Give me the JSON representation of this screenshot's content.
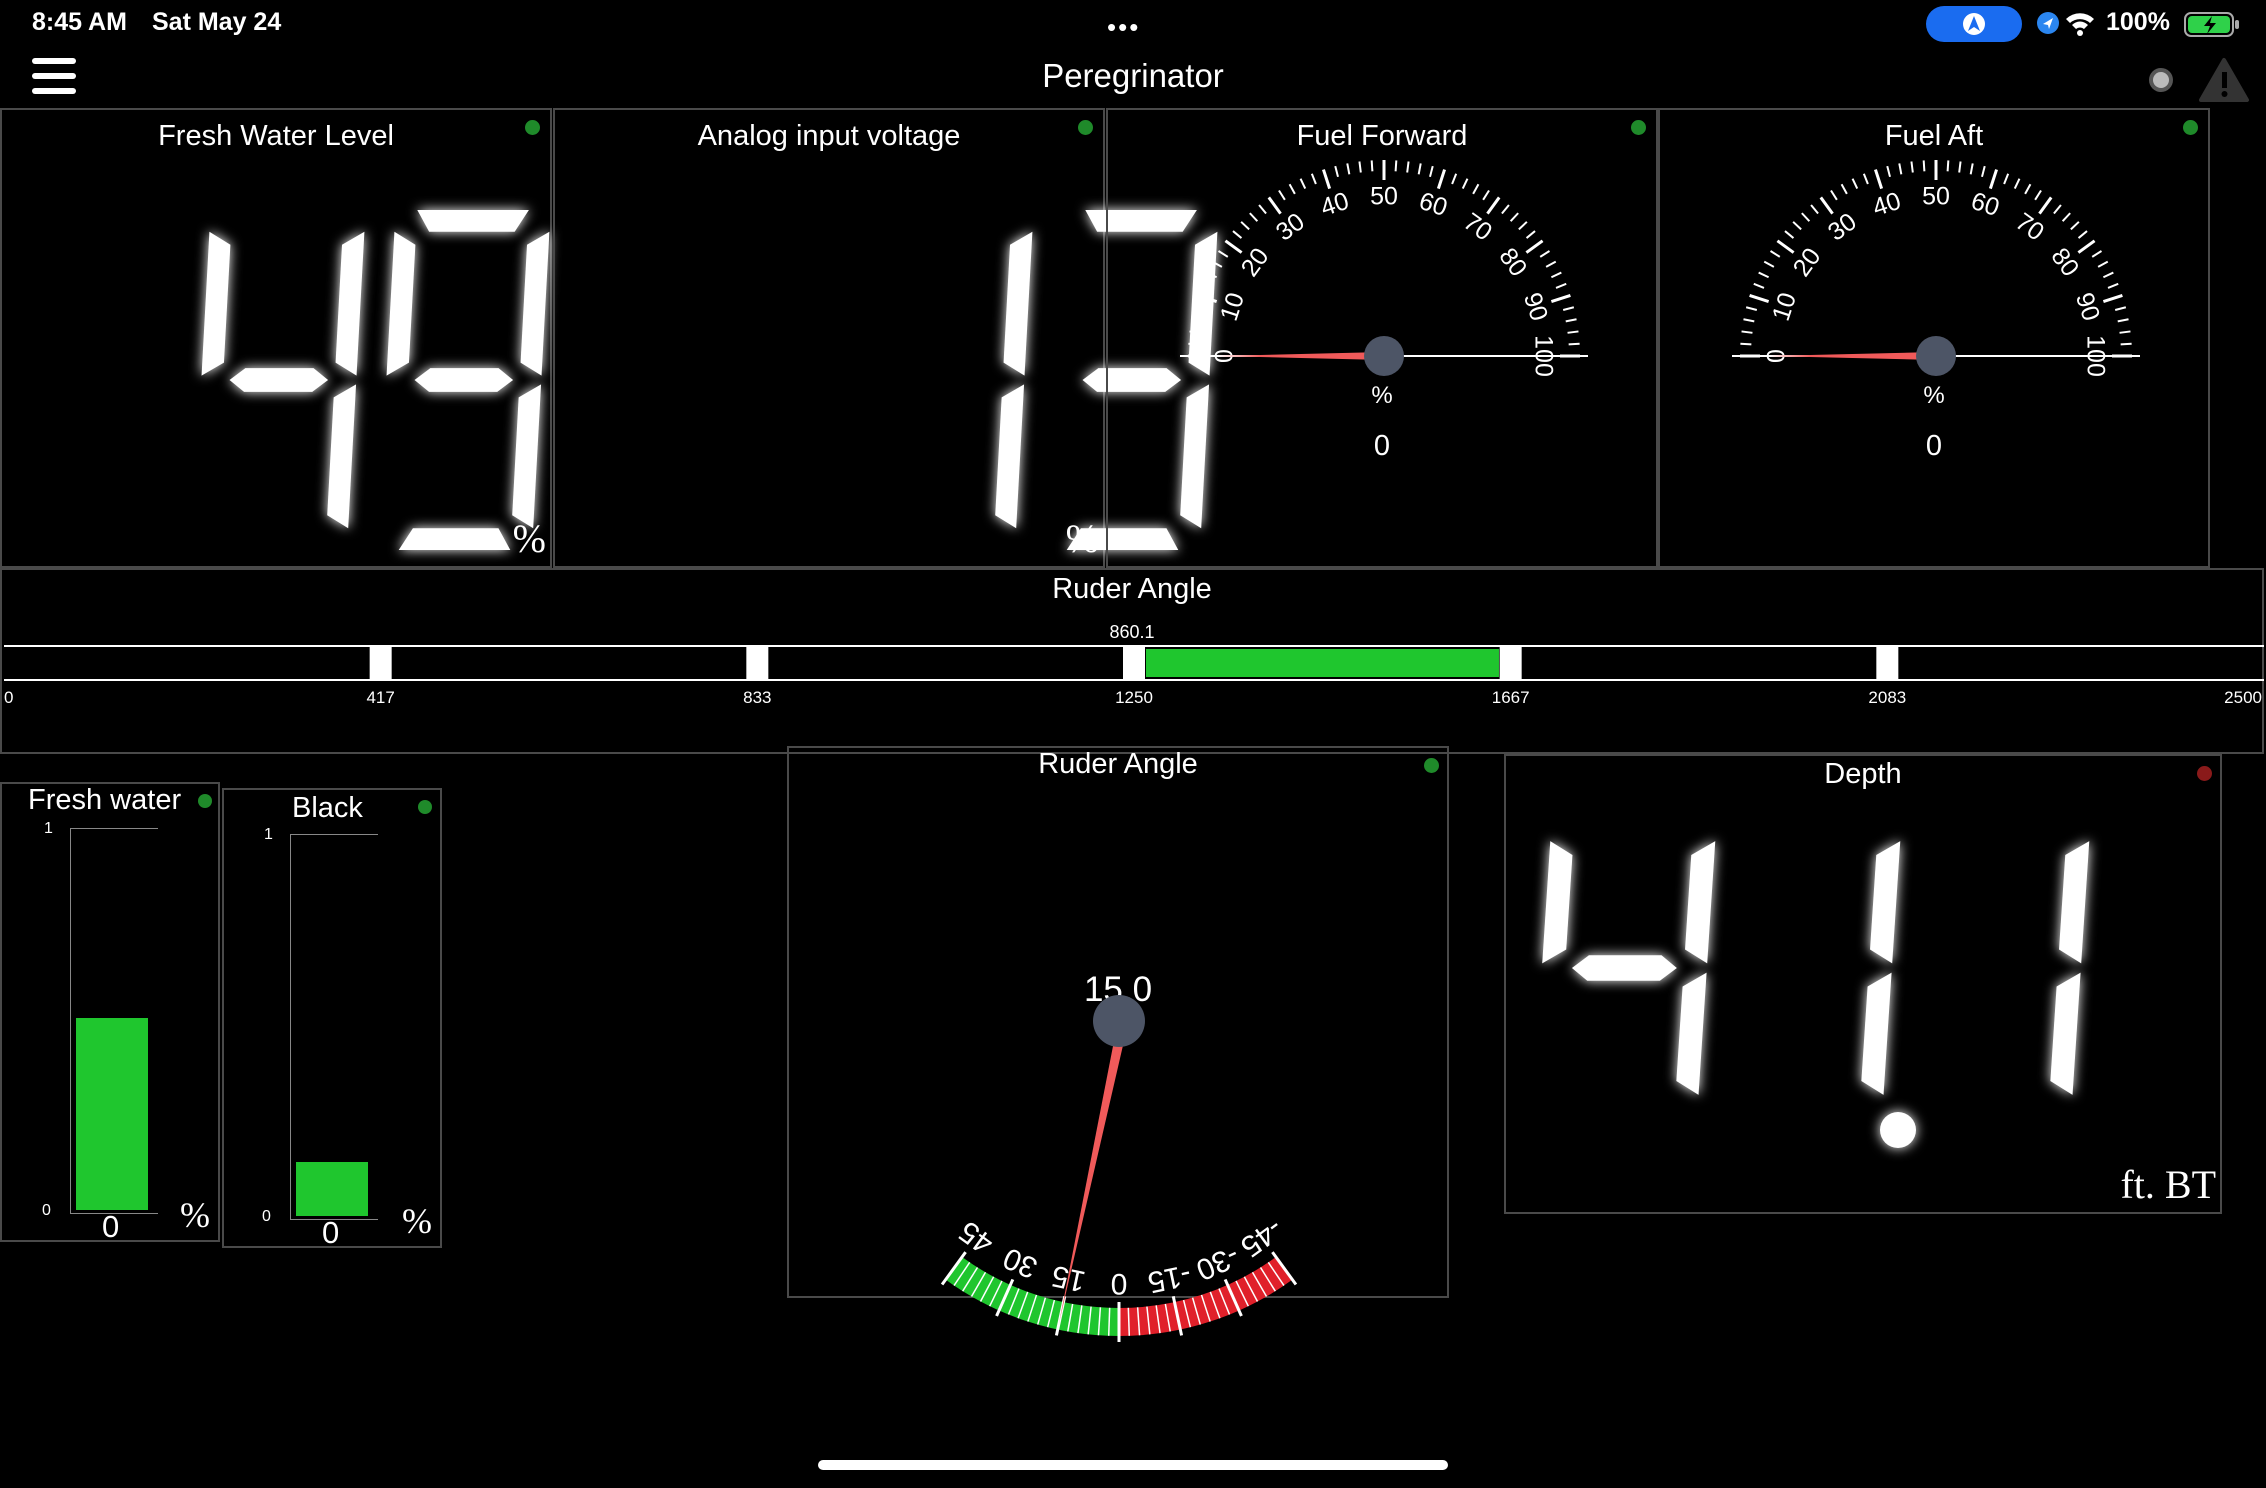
{
  "status_bar": {
    "time": "8:45 AM",
    "date": "Sat May 24",
    "battery_pct": "100%"
  },
  "header": {
    "title": "Peregrinator",
    "menu_icon": "hamburger-icon",
    "record_icon": "record-icon",
    "alert_icon": "warning-icon"
  },
  "tiles": {
    "fresh_water_level": {
      "title": "Fresh Water Level",
      "value": "49",
      "unit": "%",
      "status_color": "#1f8a2a"
    },
    "analog_input": {
      "title": "Analog input voltage",
      "value": "13",
      "unit": "%",
      "status_color": "#1f8a2a"
    },
    "fuel_forward": {
      "title": "Fuel Forward",
      "value": 0,
      "value_text": "0",
      "unit": "%",
      "status_color": "#1f8a2a",
      "scale_labels": [
        "0",
        "10",
        "20",
        "30",
        "40",
        "50",
        "60",
        "70",
        "80",
        "90",
        "100"
      ]
    },
    "fuel_aft": {
      "title": "Fuel Aft",
      "value": 0,
      "value_text": "0",
      "unit": "%",
      "status_color": "#1f8a2a",
      "scale_labels": [
        "0",
        "10",
        "20",
        "30",
        "40",
        "50",
        "60",
        "70",
        "80",
        "90",
        "100"
      ]
    },
    "rudder_bar": {
      "title": "Ruder Angle",
      "value_label": "860.1",
      "ticks": [
        "0",
        "417",
        "833",
        "1250",
        "1667",
        "2083",
        "2500"
      ],
      "range": [
        0,
        2500
      ],
      "fill_from": 1250,
      "fill_to": 1667
    },
    "fresh_water_tank": {
      "title": "Fresh water",
      "value": "0",
      "unit": "%",
      "axis_max": "1",
      "axis_min": "0",
      "fill_fraction": 0.5,
      "status_color": "#1f8a2a"
    },
    "black_tank": {
      "title": "Black",
      "value": "0",
      "unit": "%",
      "axis_max": "1",
      "axis_min": "0",
      "fill_fraction": 0.14,
      "status_color": "#1f8a2a"
    },
    "rudder_gauge": {
      "title": "Ruder Angle",
      "value": 15.0,
      "value_text": "15.0",
      "status_color": "#1f8a2a",
      "scale_labels": [
        "45",
        "30",
        "15",
        "0",
        "-15",
        "-30",
        "-45"
      ]
    },
    "depth": {
      "title": "Depth",
      "value": "41.1",
      "unit": "ft. BT",
      "status_color": "#8a1a1a"
    }
  },
  "colors": {
    "accent_green": "#1fc62e",
    "needle_red": "#f05a5a",
    "hub_gray": "#4d5566",
    "scale_red": "#e0202a"
  }
}
